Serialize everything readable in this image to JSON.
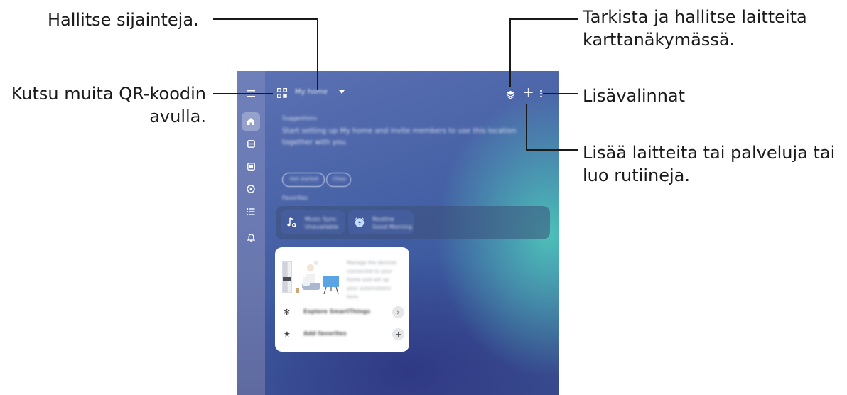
{
  "callouts": {
    "locations": "Hallitse sijainteja.",
    "qr_line1": "Kutsu muita QR-koodin",
    "qr_line2": "avulla.",
    "map_line1": "Tarkista ja hallitse laitteita",
    "map_line2": "karttanäkymässä.",
    "more_options": "Lisävalinnat",
    "add_line1": "Lisää laitteita tai palveluja tai",
    "add_line2": "luo rutiineja."
  },
  "app": {
    "location_name": "My home",
    "suggestions_title": "Suggestions",
    "suggestions_text": "Start setting up My home and invite members to use this location together with you.",
    "pill_1": "Get started",
    "pill_2": "Close",
    "favorites_title": "Favorites",
    "fav_1_line1": "Music Sync",
    "fav_1_line2": "Unavailable",
    "fav_2_line1": "Routine",
    "fav_2_line2": "Good Morning",
    "promo_text": "Manage the devices connected to your home and set up your automations here.",
    "promo_row_1": "Explore SmartThings",
    "promo_row_2": "Add favorites"
  },
  "icons": {
    "rail": [
      "menu-icon",
      "home-icon",
      "devices-icon",
      "life-icon",
      "routines-icon",
      "menu-list-icon",
      "notifications-icon"
    ],
    "topbar": [
      "qr-code-icon",
      "map-view-icon",
      "plus-icon",
      "more-options-icon"
    ]
  },
  "colors": {
    "screen_bg": "#4a64a8",
    "teal_glow": "#50d2be",
    "rail": "#6e7fba",
    "card": "#ffffff",
    "line": "#1a1a1a"
  }
}
